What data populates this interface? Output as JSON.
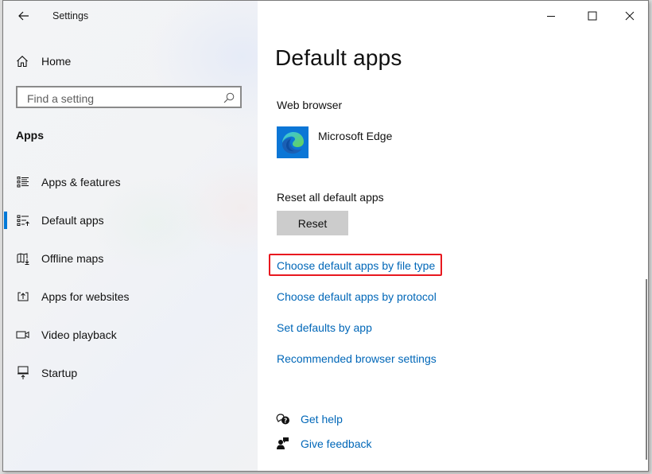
{
  "window": {
    "app_title": "Settings",
    "controls": {
      "minimize": "minimize-icon",
      "maximize": "maximize-icon",
      "close": "close-icon"
    }
  },
  "sidebar": {
    "back_icon": "back-arrow-icon",
    "home": {
      "label": "Home",
      "icon": "home-icon"
    },
    "search": {
      "placeholder": "Find a setting",
      "value": "",
      "icon": "search-icon"
    },
    "section_title": "Apps",
    "items": [
      {
        "label": "Apps & features",
        "icon": "apps-features-icon",
        "selected": false
      },
      {
        "label": "Default apps",
        "icon": "default-apps-icon",
        "selected": true
      },
      {
        "label": "Offline maps",
        "icon": "offline-maps-icon",
        "selected": false
      },
      {
        "label": "Apps for websites",
        "icon": "apps-for-websites-icon",
        "selected": false
      },
      {
        "label": "Video playback",
        "icon": "video-playback-icon",
        "selected": false
      },
      {
        "label": "Startup",
        "icon": "startup-icon",
        "selected": false
      }
    ],
    "accent_color": "#0078d7"
  },
  "main": {
    "page_title": "Default apps",
    "web_browser": {
      "heading": "Web browser",
      "app_name": "Microsoft Edge",
      "icon": "microsoft-edge-icon"
    },
    "reset": {
      "heading": "Reset all default apps",
      "button_label": "Reset"
    },
    "links": [
      {
        "label": "Choose default apps by file type",
        "highlighted": true
      },
      {
        "label": "Choose default apps by protocol",
        "highlighted": false
      },
      {
        "label": "Set defaults by app",
        "highlighted": false
      },
      {
        "label": "Recommended browser settings",
        "highlighted": false
      }
    ],
    "help": [
      {
        "label": "Get help",
        "icon": "get-help-icon"
      },
      {
        "label": "Give feedback",
        "icon": "give-feedback-icon"
      }
    ],
    "link_color": "#0067b8",
    "highlight_color": "#e8181f"
  }
}
